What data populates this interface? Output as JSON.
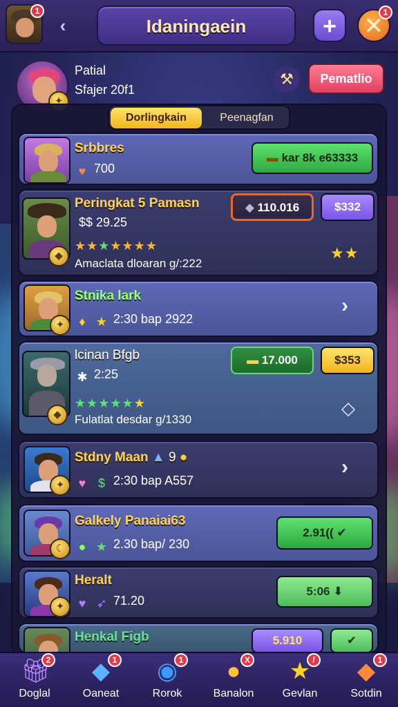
{
  "header": {
    "title": "Idaningaein",
    "avatar_badge": "1",
    "close_badge": "1",
    "plus_label": "+",
    "close_label": "✕"
  },
  "profile": {
    "name": "Patial",
    "subtitle": "Sfajer 20f1",
    "action_button": "Pematlio"
  },
  "tabs": [
    {
      "label": "Dorlingkain",
      "active": true
    },
    {
      "label": "Peenagfan",
      "active": false
    }
  ],
  "cards": [
    {
      "title": "Srbbres",
      "line1": "700",
      "button": "kar 8k e63333"
    },
    {
      "title": "Peringkat 5 Pamasn",
      "line1": "$$ 29.25",
      "line2": "Amaclata dloaran g/:222",
      "button1": "110.016",
      "button2": "$332"
    },
    {
      "title": "Stnika lark",
      "line1": "2:30 bap 2922"
    },
    {
      "title": "lcinan Bfgb",
      "line1": "2:25",
      "line2": "Fulatlat desdar g/1330",
      "button1": "17.000",
      "button2": "$353"
    },
    {
      "title": "Stdny Maan",
      "title_suffix": "9",
      "line1": "2:30 bap A557"
    },
    {
      "title": "Galkely Panaiai63",
      "line1": "2.30 bap/ 230",
      "button": "2.91(("
    },
    {
      "title": "Heralt",
      "line1": "71.20",
      "button": "5:06"
    },
    {
      "title": "Henkal Figb",
      "button": "5.910"
    }
  ],
  "bottom_nav": [
    {
      "label": "Doglal",
      "icon": "gift-icon",
      "badge": "2"
    },
    {
      "label": "Oaneat",
      "icon": "box-icon",
      "badge": "1"
    },
    {
      "label": "Rorok",
      "icon": "ring-icon",
      "badge": "1"
    },
    {
      "label": "Banalon",
      "icon": "coin-icon",
      "badge": "X"
    },
    {
      "label": "Gevlan",
      "icon": "star-icon",
      "badge": "/"
    },
    {
      "label": "Sotdin",
      "icon": "chat-icon",
      "badge": "1"
    }
  ],
  "colors": {
    "accent_gold": "#ffd257",
    "accent_green": "#5fe270",
    "accent_purple": "#7a54e6",
    "accent_pink": "#e0405f",
    "badge_red": "#e33a4a"
  }
}
